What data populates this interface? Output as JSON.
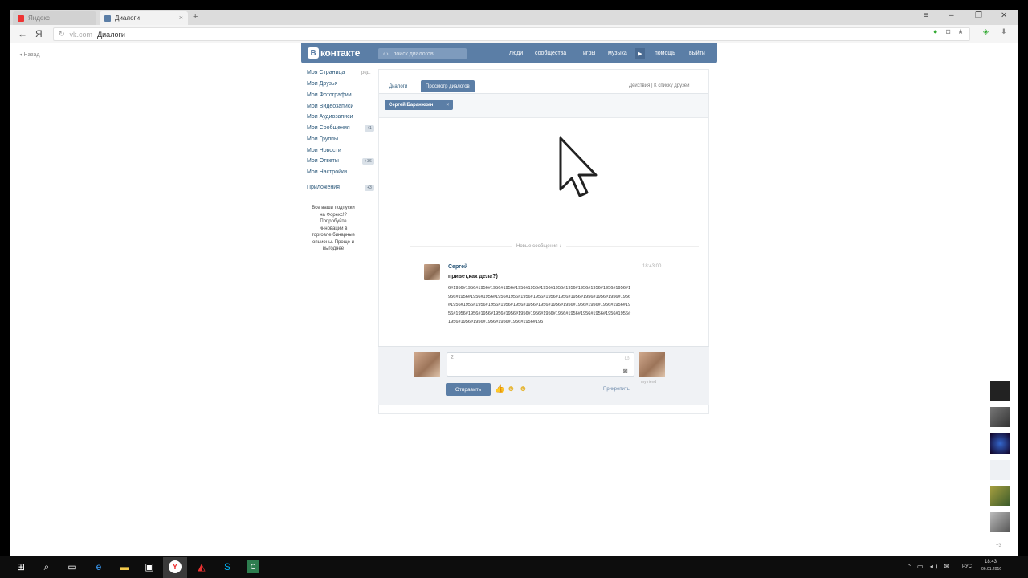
{
  "browser": {
    "tabs": [
      {
        "label": "Яндекс"
      },
      {
        "label": "Диалоги"
      }
    ],
    "new_tab": "+",
    "address": {
      "domain": "vk.com",
      "title": "Диалоги"
    },
    "back_link": "Назад"
  },
  "vk": {
    "logo": "контакте",
    "search_placeholder": "поиск диалогов",
    "nav": [
      "люди",
      "сообщества",
      "игры",
      "музыка",
      "помощь",
      "выйти"
    ],
    "menu": [
      {
        "label": "Моя Страница",
        "extra": "ред."
      },
      {
        "label": "Мои Друзья"
      },
      {
        "label": "Мои Фотографии"
      },
      {
        "label": "Мои Видеозаписи"
      },
      {
        "label": "Мои Аудиозаписи"
      },
      {
        "label": "Мои Сообщения",
        "badge": "+1"
      },
      {
        "label": "Мои Группы"
      },
      {
        "label": "Мои Новости"
      },
      {
        "label": "Мои Ответы",
        "badge": "+36"
      },
      {
        "label": "Мои Настройки"
      },
      {
        "label": "Приложения",
        "badge": "+3"
      }
    ],
    "promo": "Все ваши подпуски на Форекс!? Попробуйте инновации в торговле бинарные опционы. Проще и выгоднее",
    "tabs": {
      "dialogs": "Диалоги",
      "view": "Просмотр диалогов",
      "actions": "Действия  |  К списку друзей"
    },
    "peer": "Сергей Баранжкин",
    "new_messages": "Новые сообщения",
    "message": {
      "author": "Сергей",
      "time": "18:43:00",
      "text": "привет,как дела?)",
      "body": "6#1956#1956#1956#1956#1956#1956#1956#1956#1956#1956#1956#1956#1956#1956#1956#1956#1956#1956#1956#1956#1956#1956#1956#1956#1956#1956#1956#1956#1956#1956#1956#1956#1956#1956#1956#1956#1956#1956#1956#1956#1956#1956#1956#1956#1956#1956#1956#1956#1956#1956#1956#1956#1956#1956#1956#1956#1956#1956#1956#1956#1956#1956#1956#1956#1956#195"
    },
    "compose": {
      "placeholder": "2",
      "send": "Отправить",
      "attach": "Прикрепить",
      "right_label": "myfriend"
    }
  },
  "taskbar": {
    "lang": "РУС",
    "time": "18:43",
    "date": "06.01.2016"
  }
}
